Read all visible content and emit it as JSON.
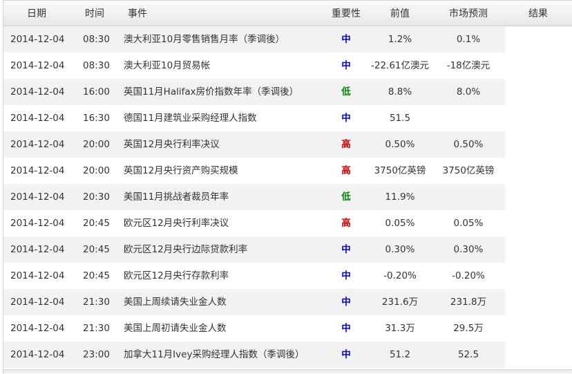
{
  "table": {
    "columns": {
      "date": "日期",
      "time": "时间",
      "event": "事件",
      "importance": "重要性",
      "previous": "前值",
      "forecast": "市场预测",
      "result": "结果"
    },
    "importance_colors": {
      "中": "#0000cc",
      "低": "#008800",
      "高": "#cc0000"
    },
    "rows": [
      {
        "date": "2014-12-04",
        "time": "08:30",
        "event": "澳大利亚10月零售销售月率（季调後）",
        "importance": "中",
        "previous": "1.2%",
        "forecast": "0.1%"
      },
      {
        "date": "2014-12-04",
        "time": "08:30",
        "event": "澳大利亚10月贸易帐",
        "importance": "中",
        "previous": "-22.61亿澳元",
        "forecast": "-18亿澳元"
      },
      {
        "date": "2014-12-04",
        "time": "16:00",
        "event": "英国11月Halifax房价指数年率（季调後）",
        "importance": "低",
        "previous": "8.8%",
        "forecast": "8.0%"
      },
      {
        "date": "2014-12-04",
        "time": "16:30",
        "event": "德国11月建筑业采购经理人指数",
        "importance": "中",
        "previous": "51.5",
        "forecast": ""
      },
      {
        "date": "2014-12-04",
        "time": "20:00",
        "event": "英国12月央行利率决议",
        "importance": "高",
        "previous": "0.50%",
        "forecast": "0.50%"
      },
      {
        "date": "2014-12-04",
        "time": "20:00",
        "event": "英国12月央行资产购买规模",
        "importance": "高",
        "previous": "3750亿英镑",
        "forecast": "3750亿英镑"
      },
      {
        "date": "2014-12-04",
        "time": "20:30",
        "event": "美国11月挑战者裁员年率",
        "importance": "低",
        "previous": "11.9%",
        "forecast": ""
      },
      {
        "date": "2014-12-04",
        "time": "20:45",
        "event": "欧元区12月央行利率决议",
        "importance": "高",
        "previous": "0.05%",
        "forecast": "0.05%"
      },
      {
        "date": "2014-12-04",
        "time": "20:45",
        "event": "欧元区12月央行边际贷款利率",
        "importance": "中",
        "previous": "0.30%",
        "forecast": "0.30%"
      },
      {
        "date": "2014-12-04",
        "time": "20:45",
        "event": "欧元区12月央行存款利率",
        "importance": "中",
        "previous": "-0.20%",
        "forecast": "-0.20%"
      },
      {
        "date": "2014-12-04",
        "time": "21:30",
        "event": "美国上周续请失业金人数",
        "importance": "中",
        "previous": "231.6万",
        "forecast": "231.8万"
      },
      {
        "date": "2014-12-04",
        "time": "21:30",
        "event": "美国上周初请失业金人数",
        "importance": "中",
        "previous": "31.3万",
        "forecast": "29.5万"
      },
      {
        "date": "2014-12-04",
        "time": "23:00",
        "event": "加拿大11月Ivey采购经理人指数（季调後）",
        "importance": "中",
        "previous": "51.2",
        "forecast": "52.5"
      }
    ]
  }
}
